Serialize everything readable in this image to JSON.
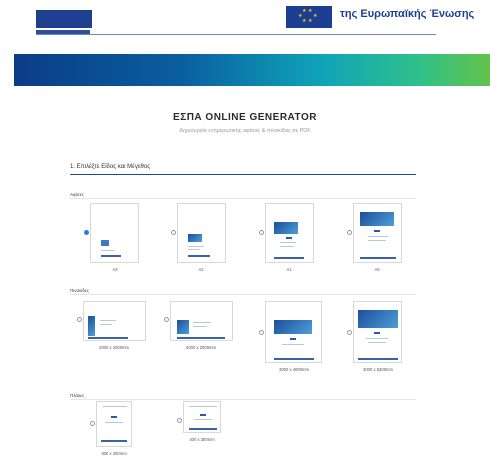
{
  "header": {
    "eu_text": "της Ευρωπαϊκής Ένωσης"
  },
  "page": {
    "title": "ΕΣΠΑ ONLINE GENERATOR",
    "subtitle": "Δημιουργία ενημερωτικής αφίσας & πινακίδας σε PDF"
  },
  "step": {
    "title": "1. Επιλέξτε Είδος και Μέγεθος"
  },
  "groups": [
    {
      "label": "Αφίσες",
      "options": [
        {
          "label": "A3",
          "selected": true
        },
        {
          "label": "A2",
          "selected": false
        },
        {
          "label": "A1",
          "selected": false
        },
        {
          "label": "A0",
          "selected": false
        }
      ]
    },
    {
      "label": "Πινακίδες",
      "options": [
        {
          "label": "2000 x 2000mm",
          "selected": false
        },
        {
          "label": "4000 x 2000mm",
          "selected": false
        },
        {
          "label": "3000 x 4000mm",
          "selected": false
        },
        {
          "label": "4000 x 5300mm",
          "selected": false
        }
      ]
    },
    {
      "label": "Πλάκες",
      "options": [
        {
          "label": "300 x 400mm",
          "selected": false
        },
        {
          "label": "400 x 300mm",
          "selected": false
        }
      ]
    }
  ],
  "colors": {
    "brand_blue": "#1c3f94",
    "radio_selected": "#2a7de1",
    "band_start": "#0a3d86",
    "band_end": "#63c24a"
  }
}
